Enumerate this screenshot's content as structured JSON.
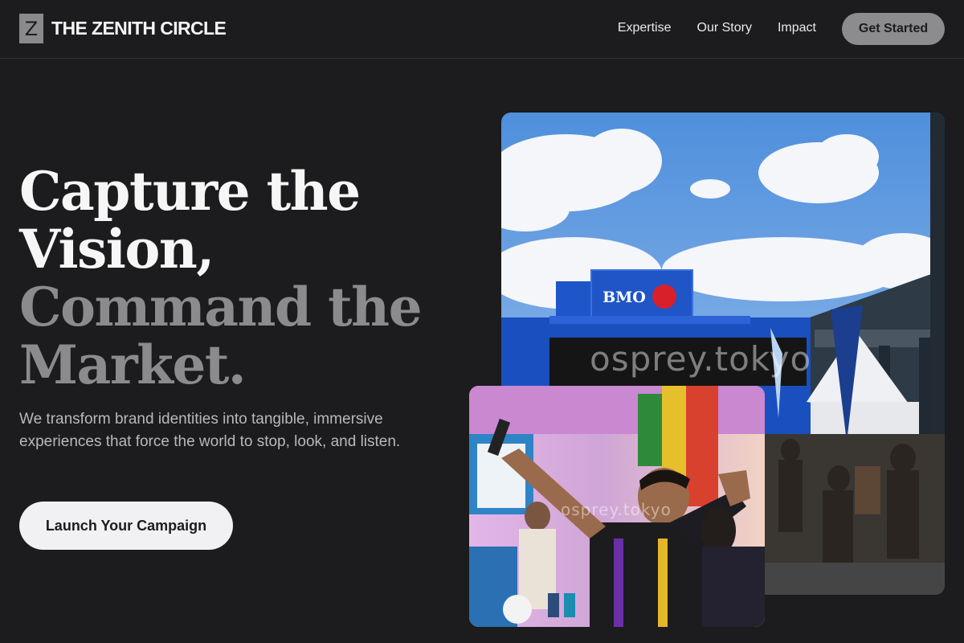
{
  "brand": {
    "mark": "Z",
    "name": "THE ZENITH CIRCLE"
  },
  "nav": {
    "items": [
      "Expertise",
      "Our Story",
      "Impact"
    ],
    "cta": "Get Started"
  },
  "hero": {
    "headline_lines": [
      "Capture the",
      "Vision,",
      "Command the",
      "Market."
    ],
    "subtitle": "We transform brand identities into tangible, immersive experiences that force the world to stop, look, and listen.",
    "cta": "Launch Your Campaign"
  },
  "images": {
    "main": {
      "sign_text": "BMO",
      "watermark": "osprey.tokyo"
    },
    "inset": {
      "watermark": "osprey.tokyo"
    }
  },
  "colors": {
    "background": "#1c1b1d",
    "text_primary": "#f6f6f7",
    "text_muted": "#8b8a8c",
    "button_light": "#f1f0f3",
    "button_gray": "#8c8b8d"
  }
}
